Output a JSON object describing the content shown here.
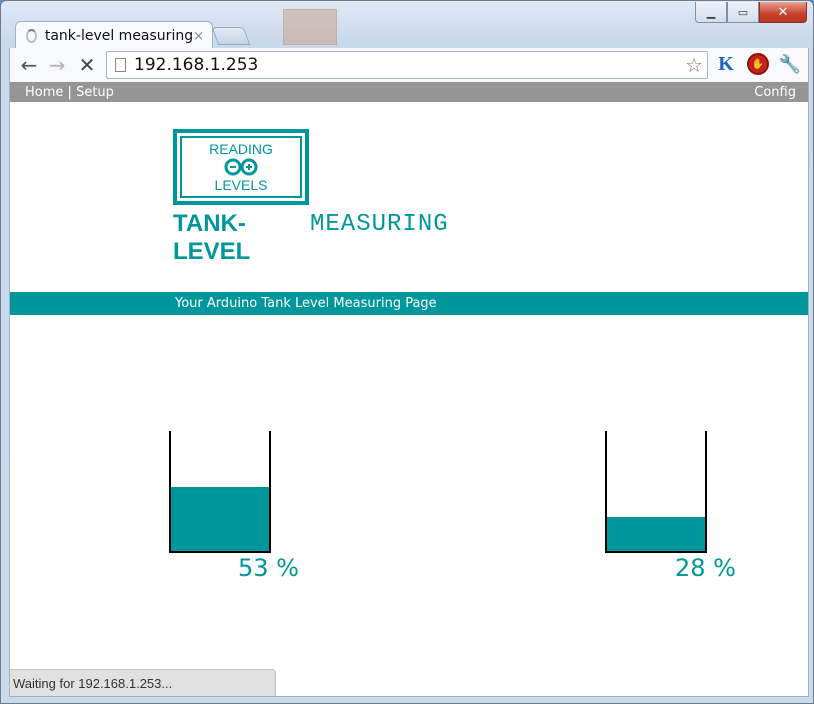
{
  "browser": {
    "tab_title": "tank-level measuring",
    "tab_close": "×",
    "url": "192.168.1.253",
    "extensions": {
      "k_label": "K"
    },
    "status_text": "Waiting for 192.168.1.253..."
  },
  "page": {
    "nav": {
      "home": "Home",
      "separator": "|",
      "setup": "Setup",
      "config": "Config"
    },
    "logo": {
      "line1": "READING",
      "line2": "LEVELS"
    },
    "title_bold": "TANK-\nLEVEL",
    "title_light": "MEASURING",
    "banner": "Your Arduino Tank Level Measuring Page",
    "accent_color": "#00979c",
    "tanks": [
      {
        "level_percent": 53,
        "label": "53 %"
      },
      {
        "level_percent": 28,
        "label": "28 %"
      }
    ]
  },
  "icons": {
    "back": "back-arrow-icon",
    "forward": "forward-arrow-icon",
    "stop": "stop-icon",
    "page": "page-icon",
    "bookmark": "star-icon",
    "adblock": "stop-sign-icon",
    "settings": "wrench-icon"
  }
}
